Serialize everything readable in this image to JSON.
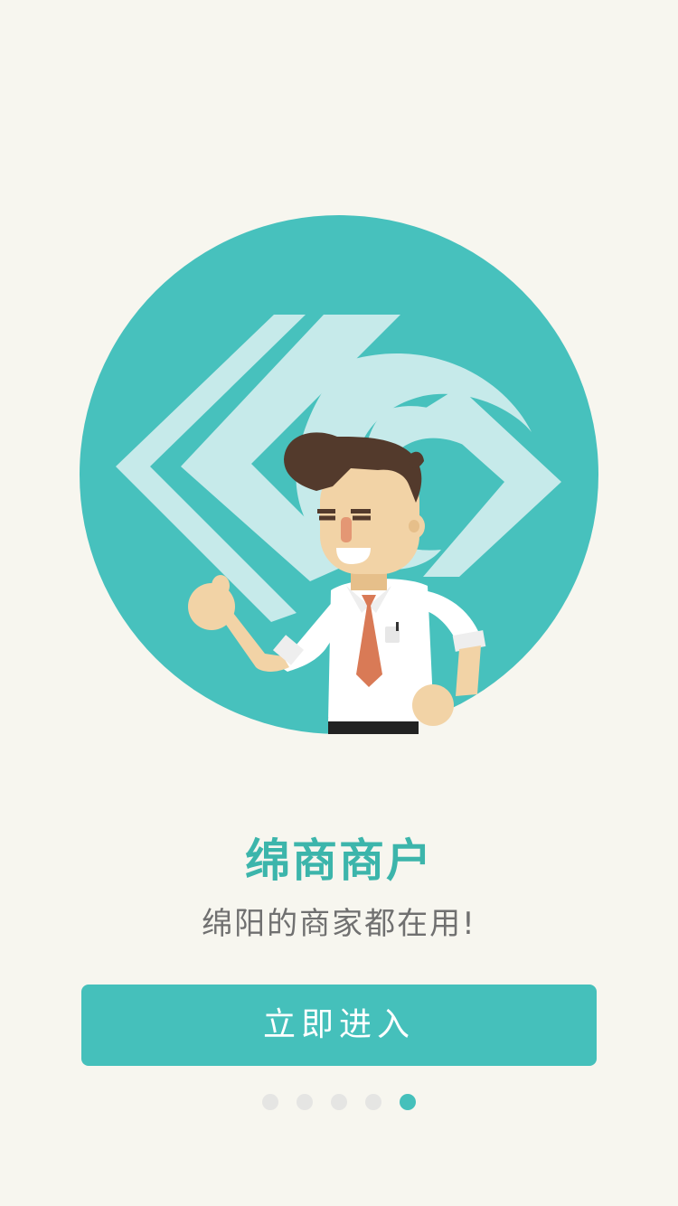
{
  "app": {
    "title": "绵商商户",
    "subtitle": "绵阳的商家都在用!"
  },
  "enter_button": {
    "label": "立即进入"
  },
  "pager": {
    "total": 5,
    "active_index": 4
  },
  "colors": {
    "background": "#f7f6ef",
    "accent": "#45c0bb",
    "title": "#3cb5ab",
    "subtitle": "#707070",
    "dot_inactive": "#e5e5e3"
  },
  "icons": [
    "brand-logo-icon",
    "businessman-illustration"
  ]
}
